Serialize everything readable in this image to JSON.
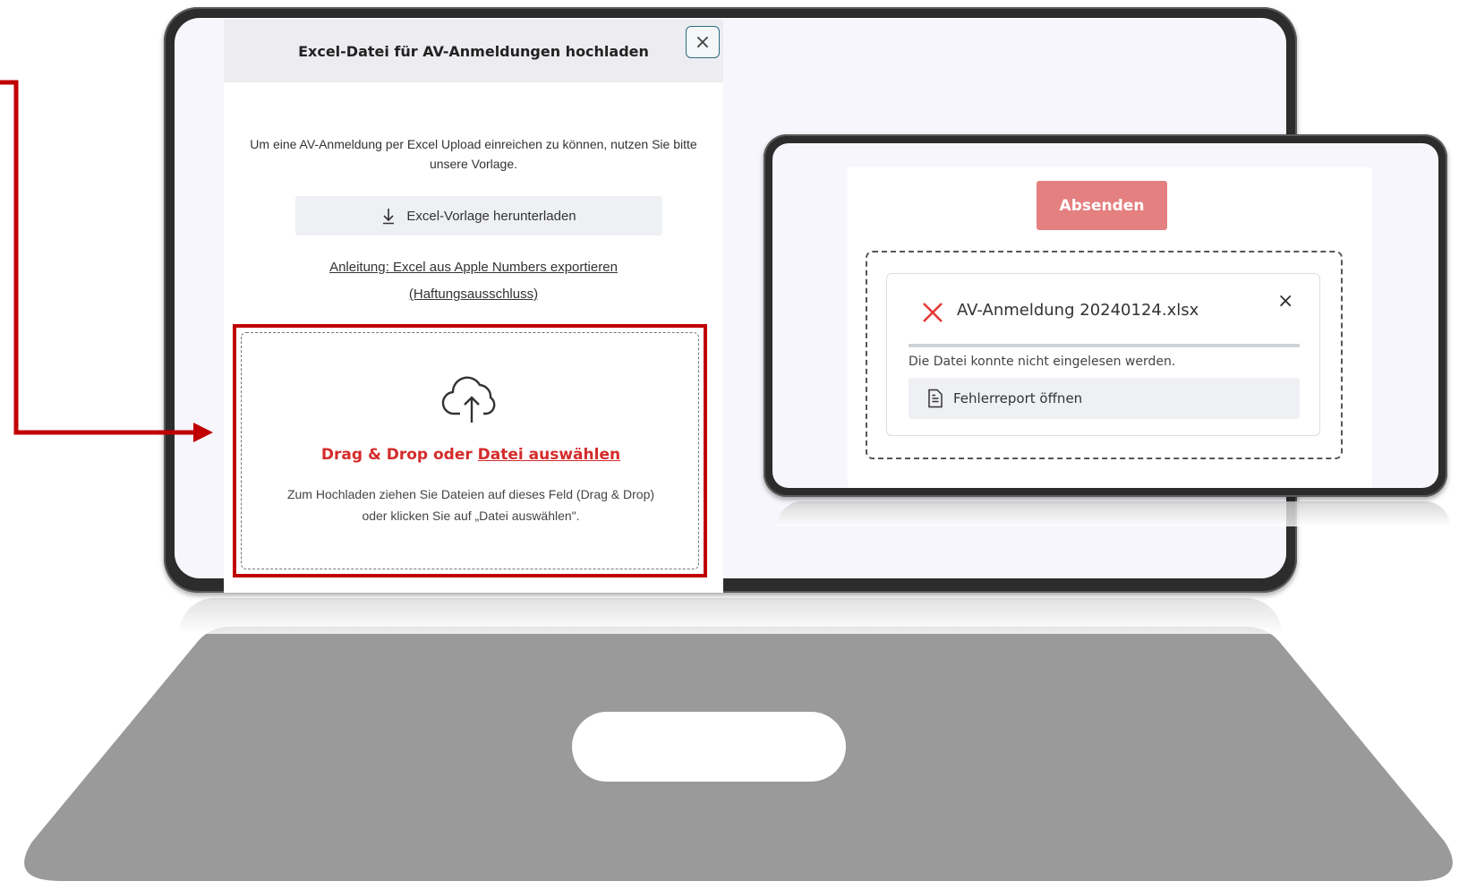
{
  "dialog": {
    "title": "Excel-Datei für AV-Anmeldungen hochladen",
    "close_symbol": "×",
    "intro": "Um eine AV-Anmeldung per Excel Upload einreichen zu können, nutzen Sie bitte unsere Vorlage.",
    "download_label": "Excel-Vorlage herunterladen",
    "download_icon": "download-arrow-icon",
    "link_numbers": "Anleitung: Excel aus Apple Numbers exportieren",
    "link_disclaimer": "(Haftungsausschluss)"
  },
  "dropzone": {
    "title_prefix": "Drag & Drop oder",
    "title_link": "Datei auswählen",
    "description": "Zum Hochladen ziehen Sie Dateien auf dieses Feld (Drag & Drop) oder klicken Sie auf „Datei auswählen\".",
    "icon": "cloud-upload-icon"
  },
  "upload_panel": {
    "submit_label": "Absenden",
    "file_name": "AV-Anmeldung 20240124.xlsx",
    "close_symbol": "×",
    "error_message": "Die Datei konnte nicht eingelesen werden.",
    "report_label": "Fehlerreport öffnen",
    "report_icon": "document-icon",
    "status_icon": "error-x-icon"
  },
  "colors": {
    "highlight_red": "#c00000",
    "link_red": "#d52b2b",
    "submit_bg": "#e58080",
    "laptop_gray": "#9a9a9a",
    "frame_dark": "#2c2c2c"
  }
}
